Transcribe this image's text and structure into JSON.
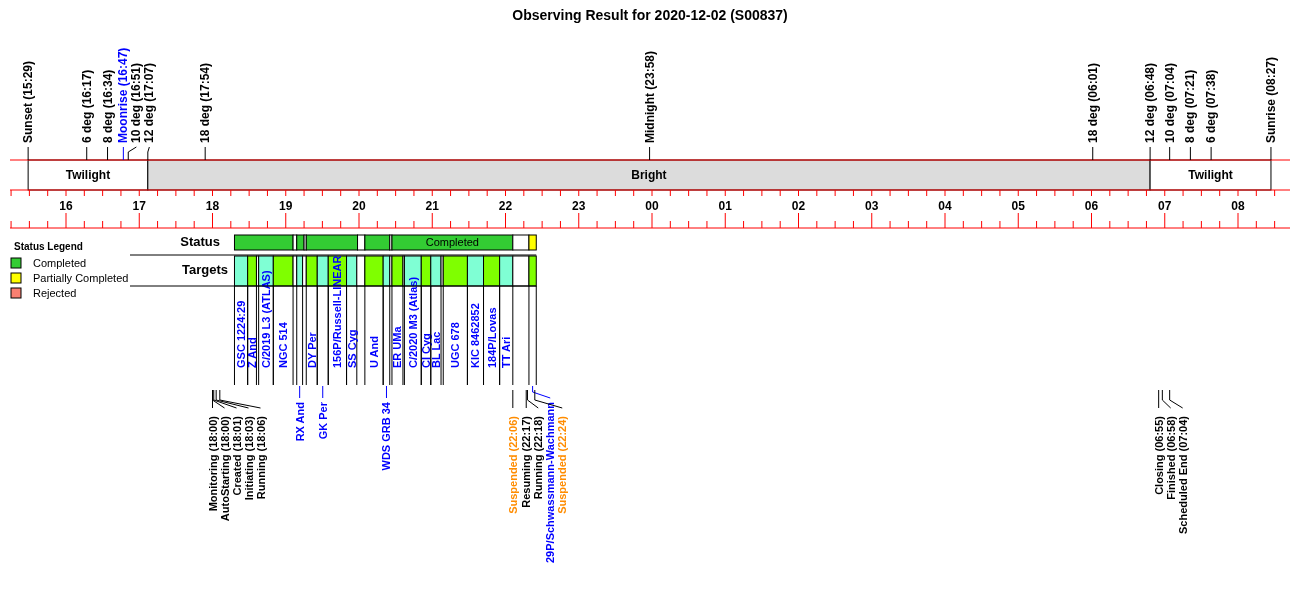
{
  "title": "Observing Result for 2020-12-02 (S00837)",
  "sky_events": [
    {
      "label": "Sunset (15:29)",
      "kind": "sun"
    },
    {
      "label": "6 deg (16:17)",
      "kind": "sun"
    },
    {
      "label": "8 deg (16:34)",
      "kind": "sun"
    },
    {
      "label": "Moonrise (16:47)",
      "kind": "moon"
    },
    {
      "label": "10 deg (16:51)",
      "kind": "sun"
    },
    {
      "label": "12 deg (17:07)",
      "kind": "sun"
    },
    {
      "label": "18 deg (17:54)",
      "kind": "sun"
    },
    {
      "label": "Midnight (23:58)",
      "kind": "sun"
    },
    {
      "label": "18 deg (06:01)",
      "kind": "sun"
    },
    {
      "label": "12 deg (06:48)",
      "kind": "sun"
    },
    {
      "label": "10 deg (07:04)",
      "kind": "sun"
    },
    {
      "label": "8 deg (07:21)",
      "kind": "sun"
    },
    {
      "label": "6 deg (07:38)",
      "kind": "sun"
    },
    {
      "label": "Sunrise (08:27)",
      "kind": "sun"
    }
  ],
  "periods": [
    {
      "label": "Twilight",
      "kind": "twilight"
    },
    {
      "label": "Bright",
      "kind": "bright"
    },
    {
      "label": "Twilight",
      "kind": "twilight"
    }
  ],
  "hour_labels": [
    "16",
    "17",
    "18",
    "19",
    "20",
    "21",
    "22",
    "23",
    "00",
    "01",
    "02",
    "03",
    "04",
    "05",
    "06",
    "07",
    "08"
  ],
  "legend": {
    "title": "Status Legend",
    "items": [
      {
        "label": "Completed",
        "color": "#33cc33"
      },
      {
        "label": "Partially Completed",
        "color": "#ffff00"
      },
      {
        "label": "Rejected",
        "color": "#fa8072"
      }
    ]
  },
  "status": {
    "label": "Status",
    "segments": [
      {
        "kind": "completed"
      },
      {
        "kind": "completed"
      },
      {
        "kind": "completed"
      },
      {
        "kind": "completed"
      },
      {
        "kind": "completed",
        "label": "Completed"
      },
      {
        "kind": "partial"
      }
    ]
  },
  "targets": {
    "label": "Targets",
    "items": [
      {
        "name": "GSC 1224:29",
        "color": "#7fffd4"
      },
      {
        "name": "Z And",
        "color": "#7fff00"
      },
      {
        "name": "C/2019 L3 (ATLAS)",
        "color": "#7fffd4"
      },
      {
        "name": "NGC 514",
        "color": "#7fff00"
      },
      {
        "name": "RX And",
        "color": "#7fffd4"
      },
      {
        "name": "DY Per",
        "color": "#7fff00"
      },
      {
        "name": "GK Per",
        "color": "#7fffd4"
      },
      {
        "name": "156P/Russell-LINEAR",
        "color": "#7fff00"
      },
      {
        "name": "SS Cyg",
        "color": "#7fffd4"
      },
      {
        "name": "U And",
        "color": "#7fff00"
      },
      {
        "name": "WDS GRB 34",
        "color": "#7fffd4"
      },
      {
        "name": "ER UMa",
        "color": "#7fff00"
      },
      {
        "name": "C/2020 M3 (Atlas)",
        "color": "#7fffd4"
      },
      {
        "name": "CI Cyg",
        "color": "#7fff00"
      },
      {
        "name": "BL Lac",
        "color": "#7fffd4"
      },
      {
        "name": "UGC 678",
        "color": "#7fff00"
      },
      {
        "name": "KIC 8462852",
        "color": "#7fffd4"
      },
      {
        "name": "184P/Lovas",
        "color": "#7fff00"
      },
      {
        "name": "TT Ari",
        "color": "#7fffd4"
      },
      {
        "name": "29P/Schwassmann-Wachmann",
        "color": "#7fff00"
      }
    ]
  },
  "run_events": [
    {
      "label": "Monitoring (18:00)",
      "kind": "normal"
    },
    {
      "label": "AutoStarting (18:00)",
      "kind": "normal"
    },
    {
      "label": "Created (18:01)",
      "kind": "normal"
    },
    {
      "label": "Initiating (18:03)",
      "kind": "normal"
    },
    {
      "label": "Running (18:06)",
      "kind": "normal"
    },
    {
      "label": "Suspended (22:06)",
      "kind": "suspended"
    },
    {
      "label": "Resuming (22:17)",
      "kind": "normal"
    },
    {
      "label": "Running (22:18)",
      "kind": "normal"
    },
    {
      "label": "Suspended (22:24)",
      "kind": "suspended"
    },
    {
      "label": "Closing (06:55)",
      "kind": "normal"
    },
    {
      "label": "Finished (06:58)",
      "kind": "normal"
    },
    {
      "label": "Scheduled End (07:04)",
      "kind": "normal"
    }
  ]
}
